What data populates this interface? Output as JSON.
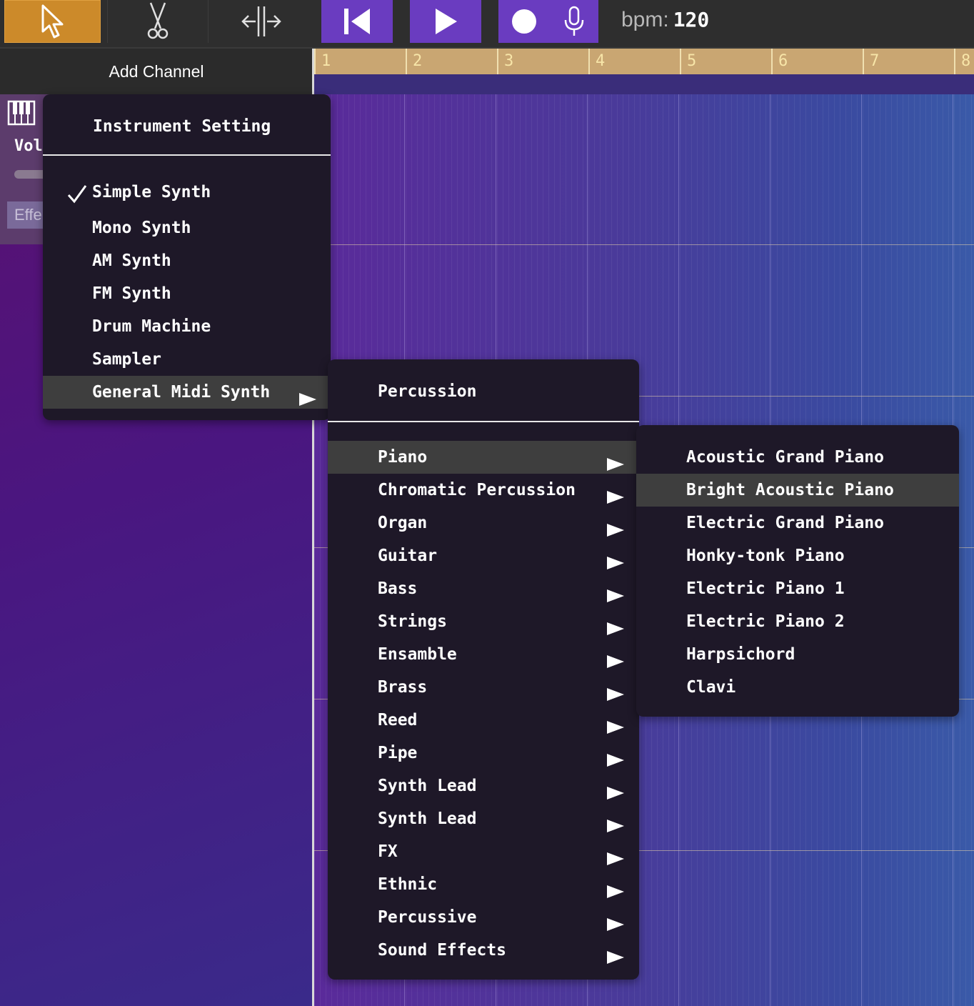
{
  "toolbar": {
    "tools": [
      {
        "icon": "pointer-icon"
      },
      {
        "icon": "scissors-icon"
      },
      {
        "icon": "split-icon"
      }
    ],
    "transport": [
      {
        "icon": "skip-back-icon"
      },
      {
        "icon": "play-icon"
      },
      {
        "icon": "record-icon"
      },
      {
        "icon": "microphone-icon"
      }
    ],
    "bpm_label": "bpm:",
    "bpm_value": "120",
    "active_tool_color": "#cc8a2a",
    "transport_color": "#6a3cc0"
  },
  "sidebar": {
    "add_channel": "Add Channel",
    "channel": {
      "icon": "piano-icon",
      "vol_label": "Vol",
      "effects_label": "Effe"
    }
  },
  "timeline": {
    "measures": [
      "1",
      "2",
      "3",
      "4",
      "5",
      "6",
      "7",
      "8"
    ]
  },
  "instrument_menu": {
    "title": "Instrument Setting",
    "items": [
      {
        "label": "Simple Synth",
        "checked": true
      },
      {
        "label": "Mono Synth"
      },
      {
        "label": "AM Synth"
      },
      {
        "label": "FM Synth"
      },
      {
        "label": "Drum Machine"
      },
      {
        "label": "Sampler"
      },
      {
        "label": "General Midi Synth",
        "submenu": true,
        "highlighted": true
      }
    ]
  },
  "gm_menu": {
    "percussion": "Percussion",
    "categories": [
      "Piano",
      "Chromatic Percussion",
      "Organ",
      "Guitar",
      "Bass",
      "Strings",
      "Ensamble",
      "Brass",
      "Reed",
      "Pipe",
      "Synth Lead",
      "Synth Lead",
      "FX",
      "Ethnic",
      "Percussive",
      "Sound Effects"
    ],
    "highlighted": "Piano"
  },
  "piano_menu": {
    "items": [
      "Acoustic Grand Piano",
      "Bright Acoustic Piano",
      "Electric Grand Piano",
      "Honky-tonk Piano",
      "Electric Piano 1",
      "Electric Piano 2",
      "Harpsichord",
      "Clavi"
    ],
    "highlighted": "Bright Acoustic Piano"
  }
}
